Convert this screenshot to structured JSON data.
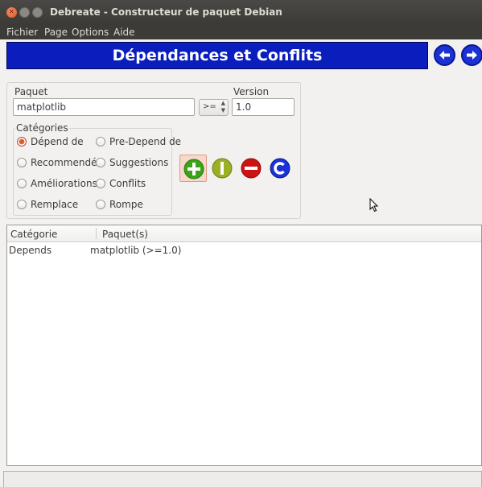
{
  "window": {
    "title": "Debreate - Constructeur de paquet Debian"
  },
  "menubar": {
    "items": [
      "Fichier",
      "Page",
      "Options",
      "Aide"
    ]
  },
  "banner": {
    "title": "Dépendances et Conflits",
    "color": "#0a1ebd"
  },
  "form": {
    "package_label": "Paquet",
    "package_value": "matplotlib",
    "operator_value": ">=",
    "version_label": "Version",
    "version_value": "1.0"
  },
  "categories": {
    "legend": "Catégories",
    "options": [
      {
        "label": "Dépend de",
        "selected": true
      },
      {
        "label": "Pre-Depend de",
        "selected": false
      },
      {
        "label": "Recommendé",
        "selected": false
      },
      {
        "label": "Suggestions",
        "selected": false
      },
      {
        "label": "Améliorations",
        "selected": false
      },
      {
        "label": "Conflits",
        "selected": false
      },
      {
        "label": "Remplace",
        "selected": false
      },
      {
        "label": "Rompe",
        "selected": false
      }
    ]
  },
  "actions": {
    "icons": [
      "add-icon",
      "append-icon",
      "remove-icon",
      "clear-icon"
    ]
  },
  "navigation": {
    "icons": [
      "arrow-left-icon",
      "arrow-right-icon"
    ]
  },
  "list": {
    "columns": [
      "Catégorie",
      "Paquet(s)"
    ],
    "rows": [
      {
        "category": "Depends",
        "packages": "matplotlib (>=1.0)"
      }
    ]
  }
}
